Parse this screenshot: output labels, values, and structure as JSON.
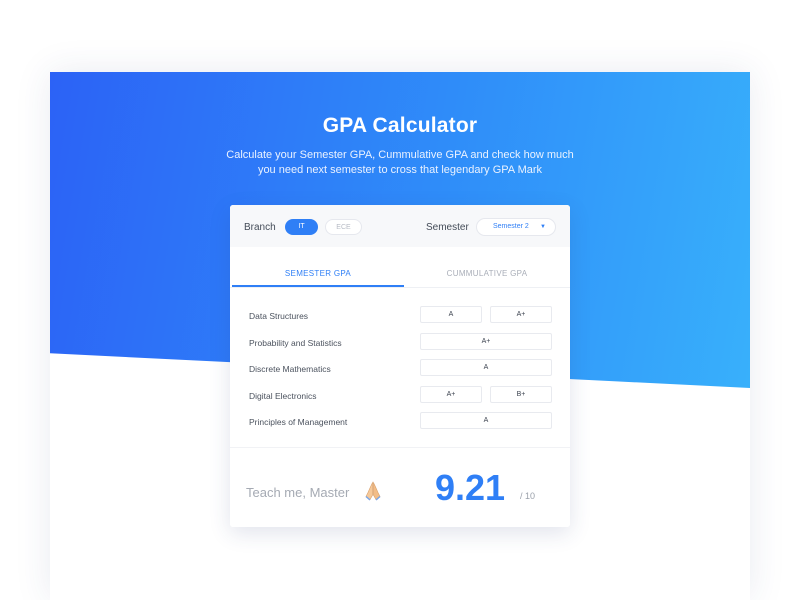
{
  "header": {
    "title": "GPA Calculator",
    "subtitle_line1": "Calculate your Semester GPA, Cummulative GPA and check how much",
    "subtitle_line2": "you need next semester to cross that legendary GPA Mark"
  },
  "calculator": {
    "branch_label": "Branch",
    "branches": [
      "IT",
      "ECE"
    ],
    "selected_branch": "IT",
    "semester_label": "Semester",
    "semester_value": "Semester 2",
    "tabs": [
      "SEMESTER GPA",
      "CUMMULATIVE GPA"
    ],
    "active_tab": "SEMESTER GPA",
    "courses": [
      {
        "name": "Data Structures",
        "grades": [
          "A",
          "A+"
        ]
      },
      {
        "name": "Probability and Statistics",
        "grades": [
          "A+"
        ]
      },
      {
        "name": "Discrete Mathematics",
        "grades": [
          "A"
        ]
      },
      {
        "name": "Digital Electronics",
        "grades": [
          "A+",
          "B+"
        ]
      },
      {
        "name": "Principles of Management",
        "grades": [
          "A"
        ]
      }
    ],
    "teach_text": "Teach me, Master",
    "gpa": "9.21",
    "gpa_max": "/ 10"
  },
  "colors": {
    "accent": "#2f7ff6",
    "gradient_start": "#2c62f6",
    "gradient_end": "#38b0fb"
  },
  "icons": {
    "semester_dropdown": "chevron-down-icon",
    "teach_emoji": "folded-hands-icon"
  }
}
